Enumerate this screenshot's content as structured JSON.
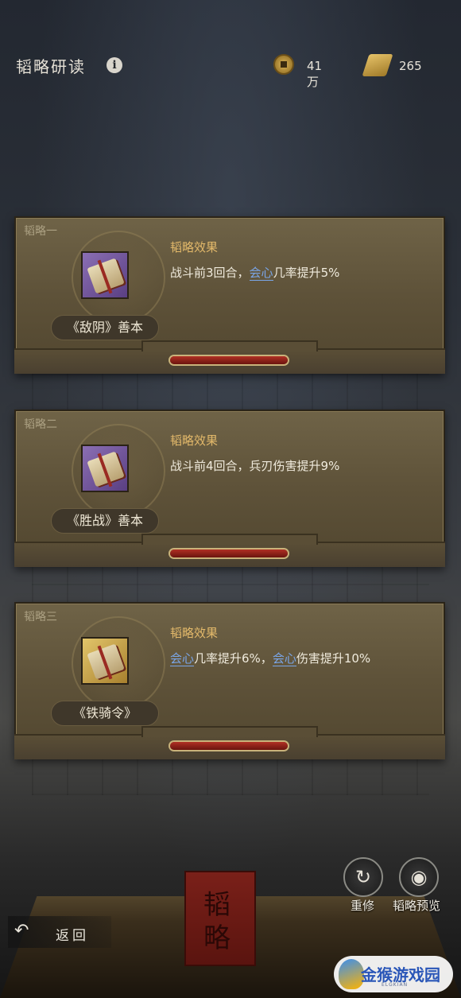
{
  "header": {
    "title": "韬略研读",
    "info_icon": "info-icon",
    "coins": {
      "icon": "coin-icon",
      "value": "41万"
    },
    "scrolls": {
      "icon": "scroll-icon",
      "value": "265"
    }
  },
  "cards": [
    {
      "slot": "韬略一",
      "item_name": "《敌阴》善本",
      "effect_title": "韬略效果",
      "effect": {
        "pre": "战斗前3回合，",
        "kw1": "会心",
        "mid": "几率提升5%",
        "kw2": "",
        "post": ""
      },
      "item_color": "#7b5ea6"
    },
    {
      "slot": "韬略二",
      "item_name": "《胜战》善本",
      "effect_title": "韬略效果",
      "effect": {
        "pre": "战斗前4回合，兵刃伤害提升9%",
        "kw1": "",
        "mid": "",
        "kw2": "",
        "post": ""
      },
      "item_color": "#7b5ea6"
    },
    {
      "slot": "韬略三",
      "item_name": "《铁骑令》",
      "effect_title": "韬略效果",
      "effect": {
        "pre": "",
        "kw1": "会心",
        "mid": "几率提升6%，",
        "kw2": "会心",
        "post": "伤害提升10%"
      },
      "item_color": "#c9a64c"
    }
  ],
  "controls": {
    "reform_label": "重修",
    "preview_label": "韬略预览",
    "back_label": "返回"
  },
  "background": {
    "book_text": "韬略"
  },
  "watermark": {
    "text": "金猴游戏园",
    "sub": "ELGKIAN"
  },
  "colors": {
    "accent_gold": "#e3b96a",
    "keyword_blue": "#7aa6e8"
  }
}
